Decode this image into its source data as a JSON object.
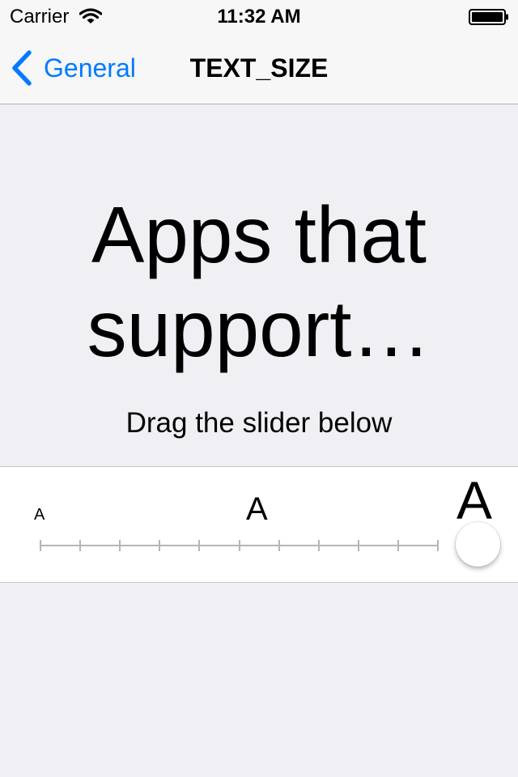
{
  "status_bar": {
    "carrier": "Carrier",
    "time": "11:32 AM",
    "icons": [
      "wifi-icon",
      "battery-icon"
    ]
  },
  "nav": {
    "back_label": "General",
    "title": "TEXT_SIZE"
  },
  "preview": {
    "heading": "Apps that support…",
    "instruction": "Drag the slider below"
  },
  "slider": {
    "small_label": "A",
    "medium_label": "A",
    "large_label": "A",
    "positions": 11,
    "value": 11,
    "max": 11
  },
  "colors": {
    "accent": "#007aff",
    "background": "#efeff4",
    "bar": "#f7f7f7",
    "panel": "#ffffff",
    "separator": "#c8c7cc"
  }
}
